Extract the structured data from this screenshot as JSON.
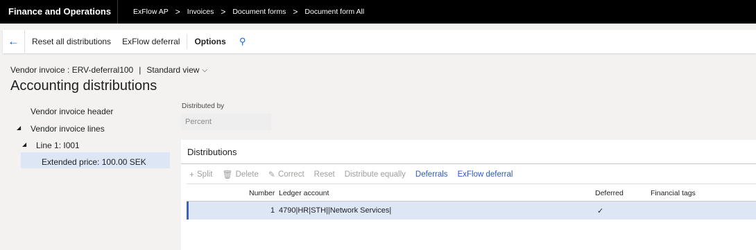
{
  "topbar": {
    "app_title": "Finance and Operations",
    "breadcrumbs": [
      "ExFlow AP",
      "Invoices",
      "Document forms",
      "Document form All"
    ],
    "separator": ">"
  },
  "actionbar": {
    "back_icon": "←",
    "actions": [
      "Reset all distributions",
      "ExFlow deferral",
      "Options"
    ],
    "search_icon": "⚲"
  },
  "header": {
    "caption": "Vendor invoice : ERV-deferral100",
    "separator": "|",
    "view": "Standard view",
    "view_chevron": "⌵",
    "title": "Accounting distributions"
  },
  "tree": {
    "items": [
      "Vendor invoice header",
      "Vendor invoice lines",
      "Line 1: I001",
      "Extended price: 100.00 SEK"
    ],
    "arrow": "◢"
  },
  "distributed_by": {
    "label": "Distributed by",
    "value": "Percent"
  },
  "distributions": {
    "title": "Distributions",
    "toolbar": [
      {
        "icon": "+",
        "label": "Split"
      },
      {
        "icon": "🗑",
        "label": "Delete"
      },
      {
        "icon": "✎",
        "label": "Correct"
      },
      {
        "icon": "",
        "label": "Reset"
      },
      {
        "icon": "",
        "label": "Distribute equally"
      },
      {
        "icon": "",
        "label": "Deferrals"
      },
      {
        "icon": "",
        "label": "ExFlow deferral"
      }
    ],
    "columns": [
      "Number",
      "Ledger account",
      "Deferred",
      "Financial tags"
    ],
    "rows": [
      {
        "number": "1",
        "ledger_account": "4790|HR|STH||Network Services|",
        "deferred": "✓",
        "financial_tags": ""
      }
    ]
  }
}
